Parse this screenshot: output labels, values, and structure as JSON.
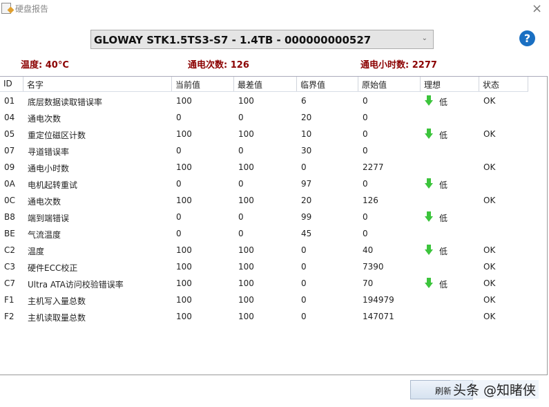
{
  "window": {
    "title": "硬盘报告",
    "close": "×"
  },
  "drive_select": {
    "value": "GLOWAY STK1.5TS3-S7 - 1.4TB - 000000000527",
    "chevron": "⌄"
  },
  "help": "?",
  "stats": {
    "temperature": "温度: 40°C",
    "power_count": "通电次数: 126",
    "power_hours": "通电小时数: 2277"
  },
  "columns": [
    "ID",
    "名字",
    "当前值",
    "最差值",
    "临界值",
    "原始值",
    "理想",
    "状态"
  ],
  "rows": [
    [
      "01",
      "底层数据读取错误率",
      "100",
      "100",
      "6",
      "0",
      "低",
      "OK"
    ],
    [
      "04",
      "通电次数",
      "0",
      "0",
      "20",
      "0",
      "",
      ""
    ],
    [
      "05",
      "重定位磁区计数",
      "100",
      "100",
      "10",
      "0",
      "低",
      "OK"
    ],
    [
      "07",
      "寻道错误率",
      "0",
      "0",
      "30",
      "0",
      "",
      ""
    ],
    [
      "09",
      "通电小时数",
      "100",
      "100",
      "0",
      "2277",
      "",
      "OK"
    ],
    [
      "0A",
      "电机起转重试",
      "0",
      "0",
      "97",
      "0",
      "低",
      ""
    ],
    [
      "0C",
      "通电次数",
      "100",
      "100",
      "20",
      "126",
      "",
      "OK"
    ],
    [
      "B8",
      "端到端错误",
      "0",
      "0",
      "99",
      "0",
      "低",
      ""
    ],
    [
      "BE",
      "气流温度",
      "0",
      "0",
      "45",
      "0",
      "",
      ""
    ],
    [
      "C2",
      "温度",
      "100",
      "100",
      "0",
      "40",
      "低",
      "OK"
    ],
    [
      "C3",
      "硬件ECC校正",
      "100",
      "100",
      "0",
      "7390",
      "",
      "OK"
    ],
    [
      "C7",
      "Ultra ATA访问校验错误率",
      "100",
      "100",
      "0",
      "70",
      "低",
      "OK"
    ],
    [
      "F1",
      "主机写入量总数",
      "100",
      "100",
      "0",
      "194979",
      "",
      "OK"
    ],
    [
      "F2",
      "主机读取量总数",
      "100",
      "100",
      "0",
      "147071",
      "",
      "OK"
    ]
  ],
  "refresh_button": "刷新",
  "watermark": "头条 @知睹侠",
  "colors": {
    "stat": "#8b0000",
    "arrow": "#3cc43c",
    "help": "#1a6fc2"
  }
}
